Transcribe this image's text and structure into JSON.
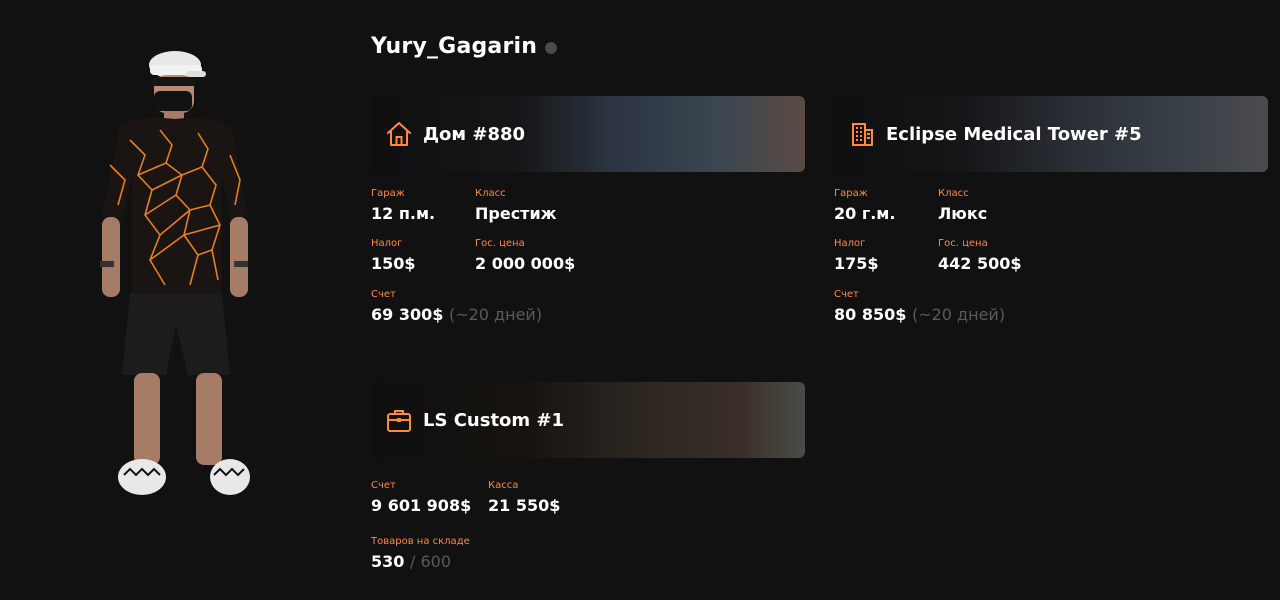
{
  "player": {
    "name": "Yury_Gagarin",
    "status_color": "#4a4a52"
  },
  "accent": "#ff8a3d",
  "properties": [
    {
      "icon": "house-icon",
      "title": "Дом #880",
      "fields": [
        {
          "label": "Гараж",
          "value": "12 п.м."
        },
        {
          "label": "Класс",
          "value": "Престиж"
        },
        {
          "label": "Налог",
          "value": "150$"
        },
        {
          "label": "Гос. цена",
          "value": "2 000 000$"
        },
        {
          "label": "Счет",
          "value": "69 300$",
          "note": "(~20 дней)"
        }
      ]
    },
    {
      "icon": "building-icon",
      "title": "Eclipse Medical Tower #5",
      "fields": [
        {
          "label": "Гараж",
          "value": "20 г.м."
        },
        {
          "label": "Класс",
          "value": "Люкс"
        },
        {
          "label": "Налог",
          "value": "175$"
        },
        {
          "label": "Гос. цена",
          "value": "442 500$"
        },
        {
          "label": "Счет",
          "value": "80 850$",
          "note": "(~20 дней)"
        }
      ]
    },
    {
      "icon": "briefcase-icon",
      "title": "LS Custom #1",
      "fields": [
        {
          "label": "Счет",
          "value": "9 601 908$"
        },
        {
          "label": "Касса",
          "value": "21 550$"
        },
        {
          "label": "Товаров на складе",
          "value": "530",
          "note": "/ 600"
        }
      ]
    }
  ]
}
